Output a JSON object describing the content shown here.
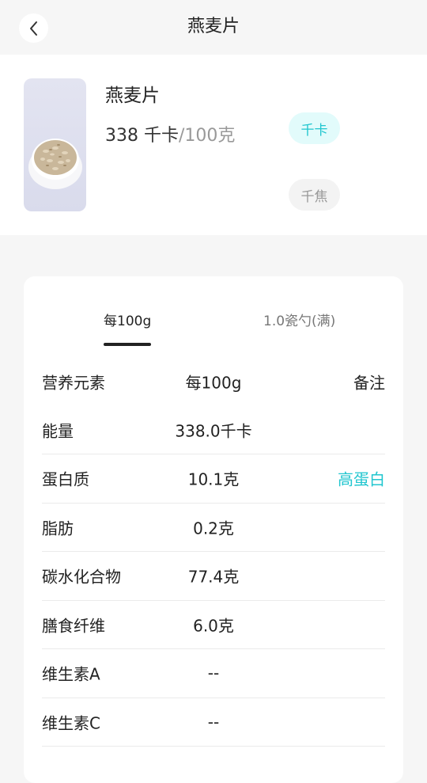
{
  "nav": {
    "title": "燕麦片"
  },
  "food": {
    "name": "燕麦片",
    "energy_value": "338 千卡",
    "energy_per": "/100克",
    "units": [
      "千卡",
      "千焦"
    ],
    "selected_unit": "千卡"
  },
  "tabs": [
    {
      "label": "每100g",
      "active": true
    },
    {
      "label": "1.0瓷勺(满)",
      "active": false
    }
  ],
  "table": {
    "headers": [
      "营养元素",
      "每100g",
      "备注"
    ],
    "rows": [
      {
        "name": "能量",
        "value": "338.0千卡",
        "note": ""
      },
      {
        "name": "蛋白质",
        "value": "10.1克",
        "note": "高蛋白"
      },
      {
        "name": "脂肪",
        "value": "0.2克",
        "note": ""
      },
      {
        "name": "碳水化合物",
        "value": "77.4克",
        "note": ""
      },
      {
        "name": "膳食纤维",
        "value": "6.0克",
        "note": ""
      },
      {
        "name": "维生素A",
        "value": "--",
        "note": ""
      },
      {
        "name": "维生素C",
        "value": "--",
        "note": ""
      }
    ]
  },
  "colors": {
    "accent": "#21c6cf",
    "accent_bg": "#e2fbfb",
    "page_bg": "#f6f6f6"
  }
}
